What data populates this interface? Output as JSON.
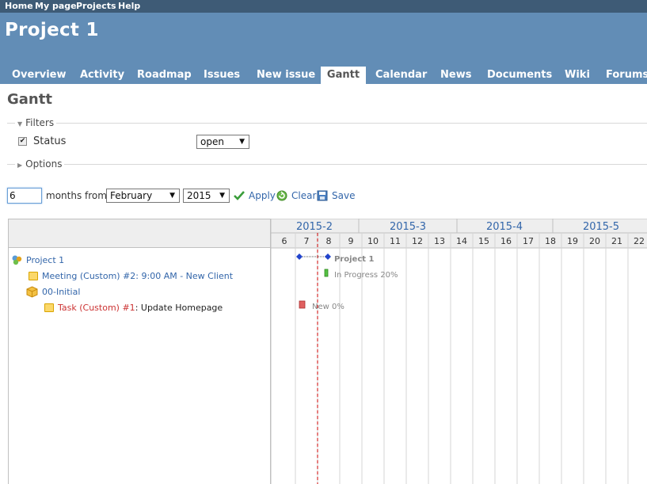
{
  "top_menu": [
    "Home",
    "My page",
    "Projects",
    "Help"
  ],
  "project_title": "Project 1",
  "tabs": [
    "Overview",
    "Activity",
    "Roadmap",
    "Issues",
    "New issue",
    "Gantt",
    "Calendar",
    "News",
    "Documents",
    "Wiki",
    "Forums"
  ],
  "selected_tab": "Gantt",
  "page_title": "Gantt",
  "filters": {
    "legend": "Filters",
    "status_label": "Status",
    "status_checked": true,
    "status_value": "open"
  },
  "options_legend": "Options",
  "controls": {
    "months": "6",
    "months_from_label": "months from",
    "month": "February",
    "year": "2015",
    "apply_label": "Apply",
    "clear_label": "Clear",
    "save_label": "Save"
  },
  "gantt": {
    "weeks": [
      "2015-2",
      "2015-3",
      "2015-4",
      "2015-5"
    ],
    "days": [
      "6",
      "7",
      "8",
      "9",
      "10",
      "11",
      "12",
      "13",
      "14",
      "15",
      "16",
      "17",
      "18",
      "19",
      "20",
      "21",
      "22"
    ],
    "rows": [
      {
        "subject": "Project 1",
        "type": "project"
      },
      {
        "tracker": "Meeting (Custom) #2",
        "subject": "9:00 AM - New Client",
        "type": "issue"
      },
      {
        "subject": "00-Initial",
        "type": "version"
      },
      {
        "tracker": "Task (Custom) #1",
        "subject": "Update Homepage",
        "type": "issue"
      }
    ],
    "bar_labels": {
      "project": "Project 1",
      "meeting": "In Progress 20%",
      "task": "New 0%"
    }
  },
  "colors": {
    "header_bg": "#628db6",
    "top_menu_bg": "#3e5b76",
    "link": "#3366aa",
    "today_line": "#cc0000",
    "task_overdue": "#cc3333"
  }
}
